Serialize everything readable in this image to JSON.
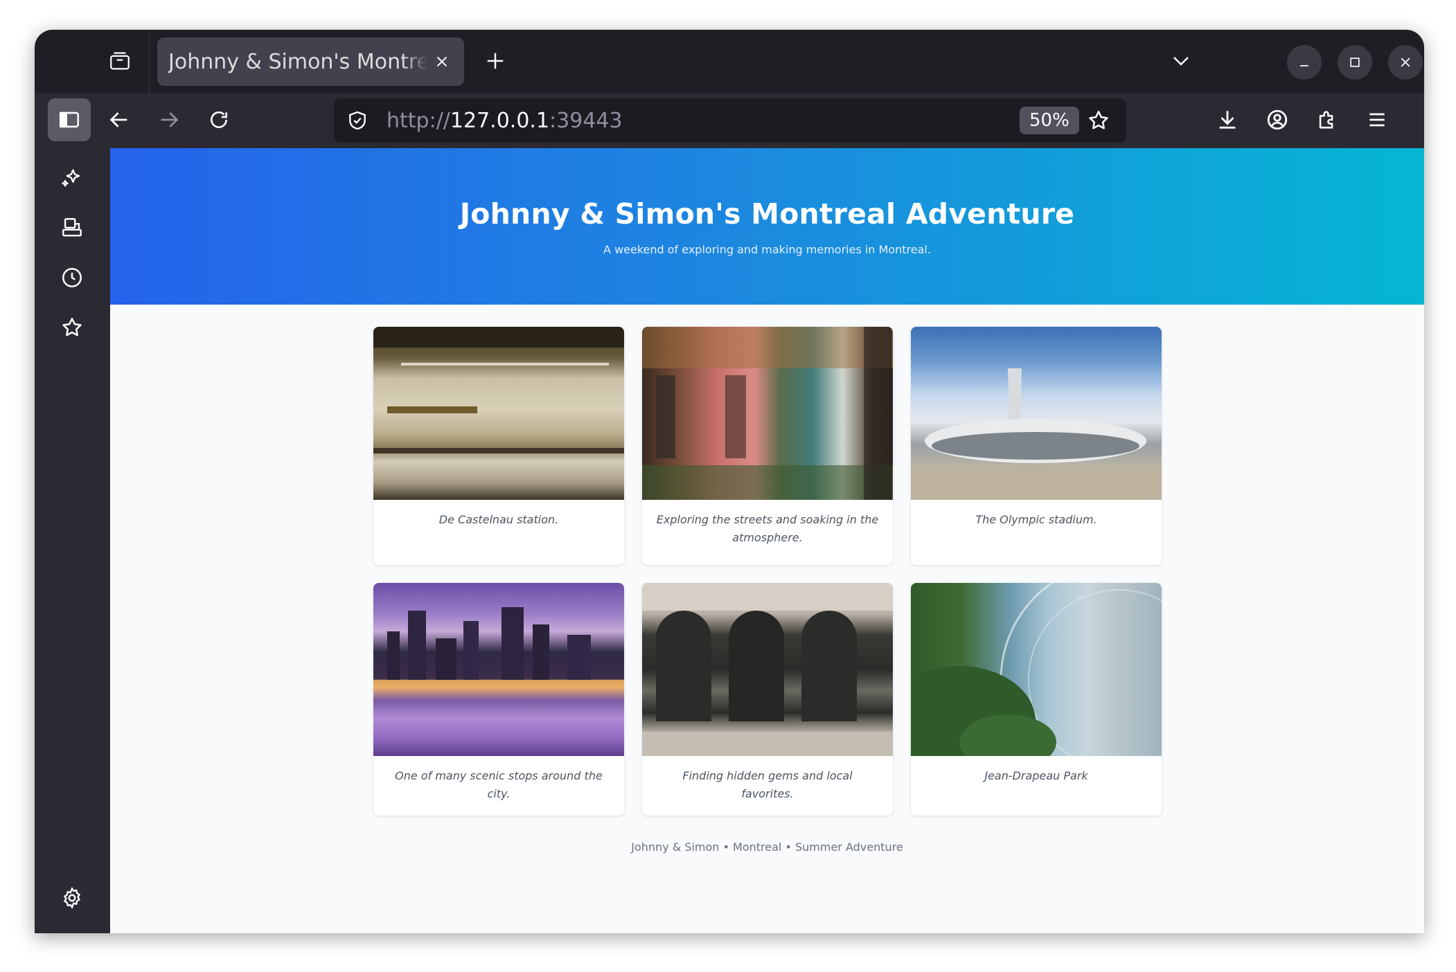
{
  "browser": {
    "tab_title": "Johnny & Simon's Montreal Adventure",
    "url_scheme": "http://",
    "url_host": "127.0.0.1",
    "url_port": ":39443",
    "zoom": "50%"
  },
  "page": {
    "title": "Johnny & Simon's Montreal Adventure",
    "subtitle": "A weekend of exploring and making memories in Montreal.",
    "footer": "Johnny & Simon • Montreal • Summer Adventure",
    "photos": [
      {
        "caption": "De Castelnau station."
      },
      {
        "caption": "Exploring the streets and soaking in the atmosphere."
      },
      {
        "caption": "The Olympic stadium."
      },
      {
        "caption": "One of many scenic stops around the city."
      },
      {
        "caption": "Finding hidden gems and local favorites."
      },
      {
        "caption": "Jean-Drapeau Park"
      }
    ]
  },
  "colors": {
    "hero_start": "#2563eb",
    "hero_end": "#06b6d4",
    "chrome_dark": "#2b2a33"
  },
  "icons": {
    "tab_manager": "tab-manager-icon",
    "tab_close": "close-icon",
    "new_tab": "plus-icon",
    "tab_list": "chevron-down-icon",
    "sidebar_toggle": "sidebar-icon",
    "back": "arrow-left-icon",
    "forward": "arrow-right-icon",
    "reload": "reload-icon",
    "site_info": "shield-icon",
    "bookmark": "star-icon",
    "downloads": "download-icon",
    "account": "account-icon",
    "extensions": "puzzle-icon",
    "menu": "hamburger-icon",
    "ai": "sparkle-icon",
    "synced_tabs": "synced-tabs-icon",
    "history": "clock-icon",
    "bookmarks": "star-icon",
    "settings": "gear-icon"
  }
}
